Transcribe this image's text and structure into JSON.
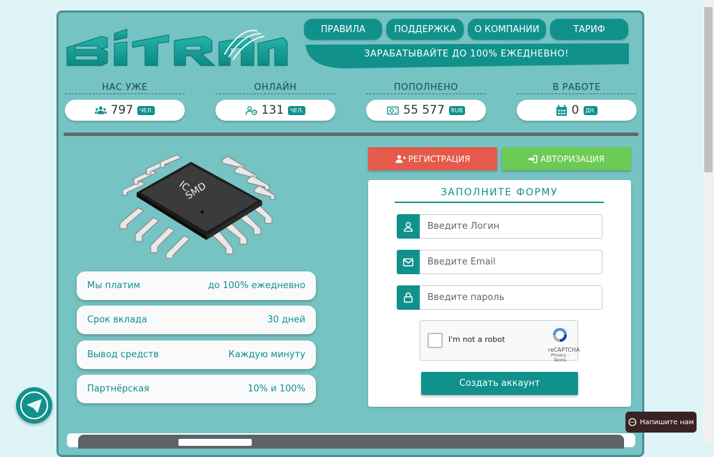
{
  "logo": {
    "text": "BITRON"
  },
  "nav": [
    {
      "label": "ПРАВИЛА"
    },
    {
      "label": "ПОДДЕРЖКА"
    },
    {
      "label": "О КОМПАНИИ"
    },
    {
      "label": "ТАРИФ"
    }
  ],
  "slogan": "ЗАРАБАТЫВАЙТЕ ДО 100% ЕЖЕДНЕВНО!",
  "stats": [
    {
      "label": "НАС УЖЕ",
      "value": "797",
      "unit": "ЧЕЛ.",
      "icon": "users-icon"
    },
    {
      "label": "ОНЛАЙН",
      "value": "131",
      "unit": "ЧЕЛ.",
      "icon": "user-clock-icon"
    },
    {
      "label": "ПОПОЛНЕНО",
      "value": "55 577",
      "unit": "RUB",
      "icon": "money-icon"
    },
    {
      "label": "В РАБОТЕ",
      "value": "0",
      "unit": "ДН.",
      "icon": "calendar-icon"
    }
  ],
  "chip": {
    "line1": "IC",
    "line2": "SMD"
  },
  "info": [
    {
      "label": "Мы платим",
      "value": "до 100% ежедневно"
    },
    {
      "label": "Срок вклада",
      "value": "30 дней"
    },
    {
      "label": "Вывод средств",
      "value": "Каждую минуту"
    },
    {
      "label": "Партнёрская",
      "value": "10% и 100%"
    }
  ],
  "auth": {
    "register_label": "РЕГИСТРАЦИЯ",
    "login_label": "АВТОРИЗАЦИЯ"
  },
  "form": {
    "title": "ЗАПОЛНИТЕ ФОРМУ",
    "login_placeholder": "Введите Логин",
    "email_placeholder": "Введите Email",
    "password_placeholder": "Введите пароль",
    "submit_label": "Создать аккаунт"
  },
  "captcha": {
    "text": "I'm not a robot",
    "brand": "reCAPTCHA",
    "links": "Privacy - Terms"
  },
  "chat": {
    "label": "Напишите нам"
  },
  "colors": {
    "accent": "#10918c",
    "panel": "#76c3c3",
    "register": "#e55a4a",
    "login": "#6ccb54"
  }
}
